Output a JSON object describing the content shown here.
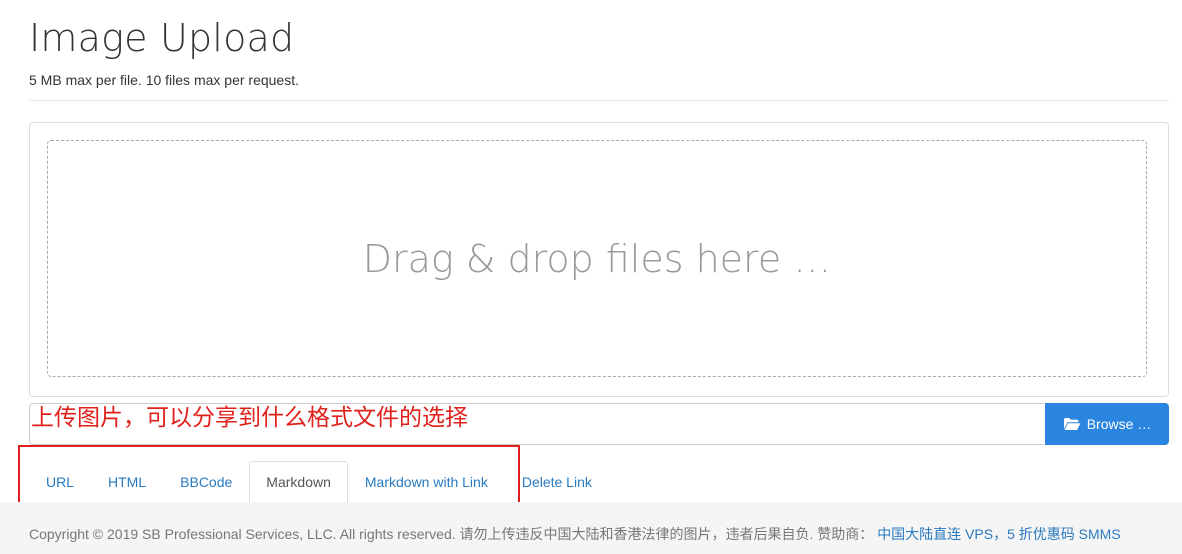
{
  "header": {
    "title": "Image Upload",
    "subtitle": "5 MB max per file. 10 files max per request."
  },
  "upload": {
    "drop_text": "Drag & drop files here …",
    "browse_label": "Browse …",
    "browse_icon": "folder-open-icon"
  },
  "annotation": {
    "text": "上传图片，可以分享到什么格式文件的选择",
    "color": "#e0201b"
  },
  "tabs": [
    {
      "label": "URL",
      "active": false
    },
    {
      "label": "HTML",
      "active": false
    },
    {
      "label": "BBCode",
      "active": false
    },
    {
      "label": "Markdown",
      "active": true
    },
    {
      "label": "Markdown with Link",
      "active": false
    },
    {
      "label": "Delete Link",
      "active": false
    }
  ],
  "footer": {
    "copyright": "Copyright © 2019 SB Professional Services, LLC. All rights reserved. 请勿上传违反中国大陆和香港法律的图片，违者后果自负. 赞助商：",
    "sponsor_link": "中国大陆直连 VPS，5 折优惠码 SMMS"
  },
  "colors": {
    "accent": "#2a85e0",
    "link": "#2a7ac0",
    "annotation": "#e02020"
  }
}
